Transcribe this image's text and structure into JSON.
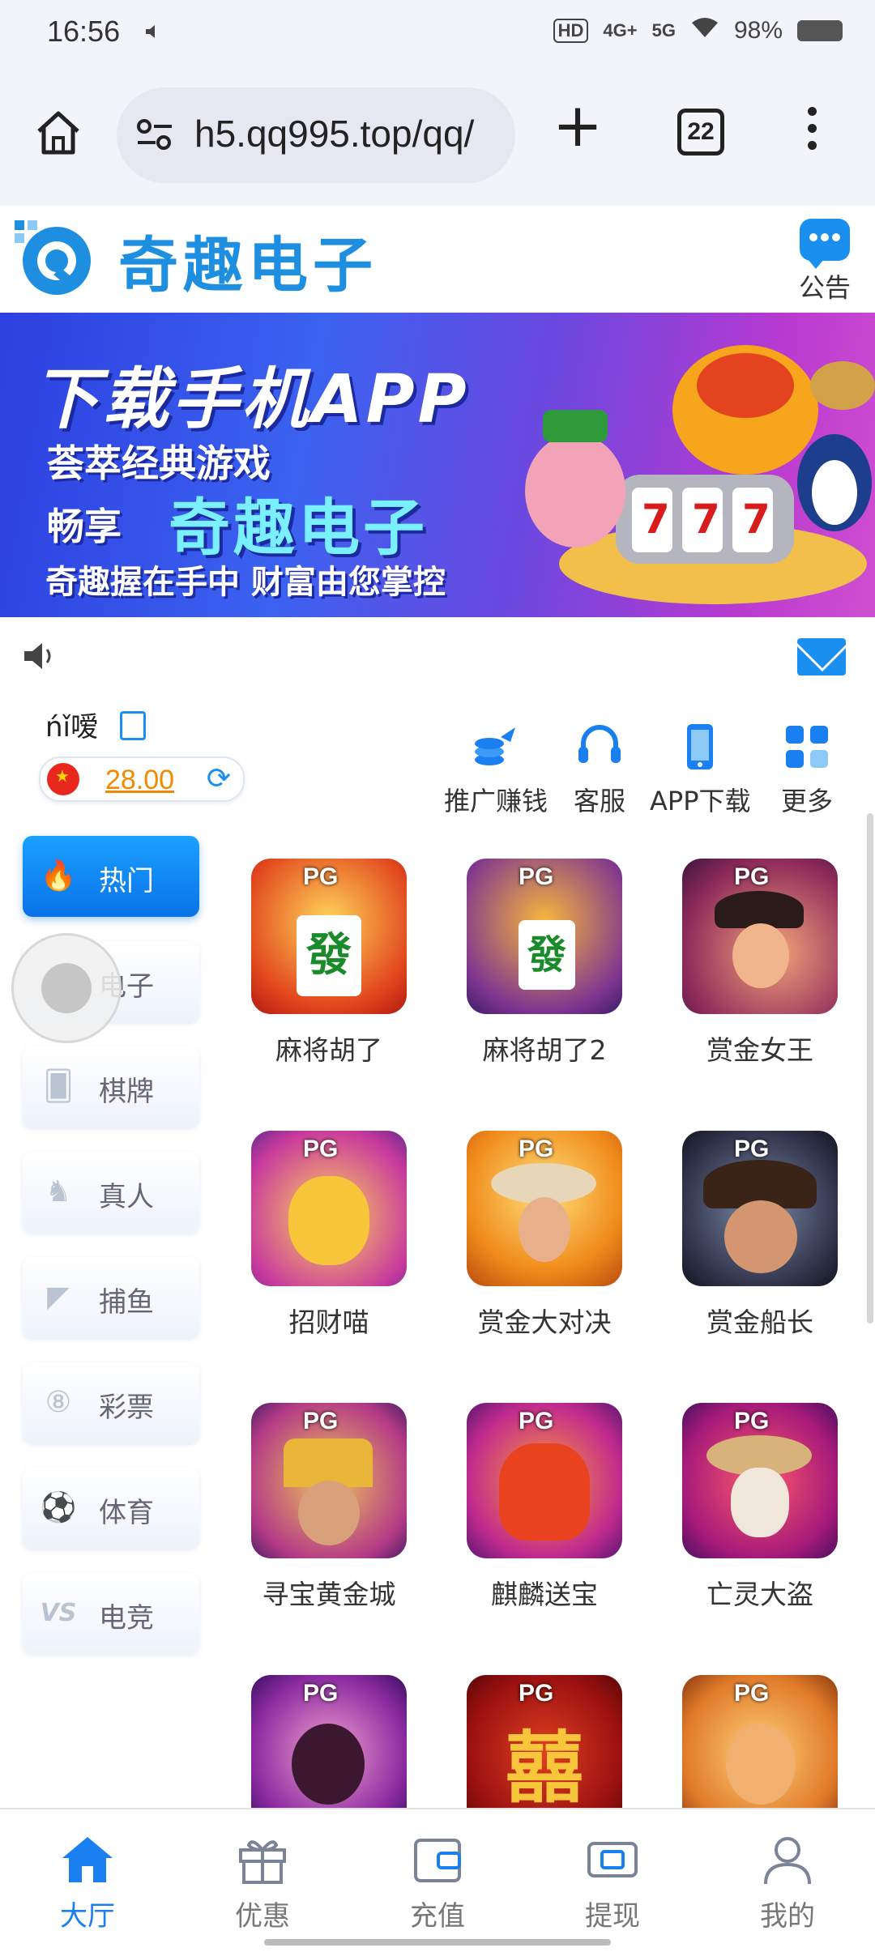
{
  "status_bar": {
    "time": "16:56",
    "network_badge": "HD",
    "net1": "4G+",
    "net2": "5G",
    "battery": "98%"
  },
  "browser": {
    "url": "h5.qq995.top/qq/",
    "tab_count": "22"
  },
  "site": {
    "logo_text": "奇趣电子",
    "notice_label": "公告"
  },
  "banner": {
    "title": "下载手机APP",
    "line1": "荟萃经典游戏",
    "line2_prefix": "畅享",
    "line2_brand": "奇趣电子",
    "line3": "奇趣握在手中 财富由您掌控"
  },
  "user": {
    "name": "ńǐ嗳",
    "balance": "28.00"
  },
  "quick_actions": [
    {
      "label": "推广赚钱"
    },
    {
      "label": "客服"
    },
    {
      "label": "APP下载"
    },
    {
      "label": "更多"
    }
  ],
  "categories": [
    {
      "label": "热门",
      "icon": "fire-icon"
    },
    {
      "label": "电子",
      "icon": "slot-icon"
    },
    {
      "label": "棋牌",
      "icon": "cards-icon"
    },
    {
      "label": "真人",
      "icon": "dealer-icon"
    },
    {
      "label": "捕鱼",
      "icon": "fish-icon"
    },
    {
      "label": "彩票",
      "icon": "lottery-ball-icon"
    },
    {
      "label": "体育",
      "icon": "soccer-ball-icon"
    },
    {
      "label": "电竞",
      "icon": "vs-icon"
    }
  ],
  "games": [
    {
      "name": "麻将胡了",
      "badge": "PG"
    },
    {
      "name": "麻将胡了2",
      "badge": "PG"
    },
    {
      "name": "赏金女王",
      "badge": "PG"
    },
    {
      "name": "招财喵",
      "badge": "PG"
    },
    {
      "name": "赏金大对决",
      "badge": "PG"
    },
    {
      "name": "赏金船长",
      "badge": "PG"
    },
    {
      "name": "寻宝黄金城",
      "badge": "PG"
    },
    {
      "name": "麒麟送宝",
      "badge": "PG"
    },
    {
      "name": "亡灵大盗",
      "badge": "PG"
    },
    {
      "name": "",
      "badge": "PG"
    },
    {
      "name": "",
      "badge": "PG"
    },
    {
      "name": "",
      "badge": "PG"
    }
  ],
  "bottom_nav": [
    {
      "label": "大厅"
    },
    {
      "label": "优惠"
    },
    {
      "label": "充值"
    },
    {
      "label": "提现"
    },
    {
      "label": "我的"
    }
  ],
  "colors": {
    "accent": "#1a8ff0",
    "balance": "#f08a00",
    "brand": "#1e8fe0"
  }
}
